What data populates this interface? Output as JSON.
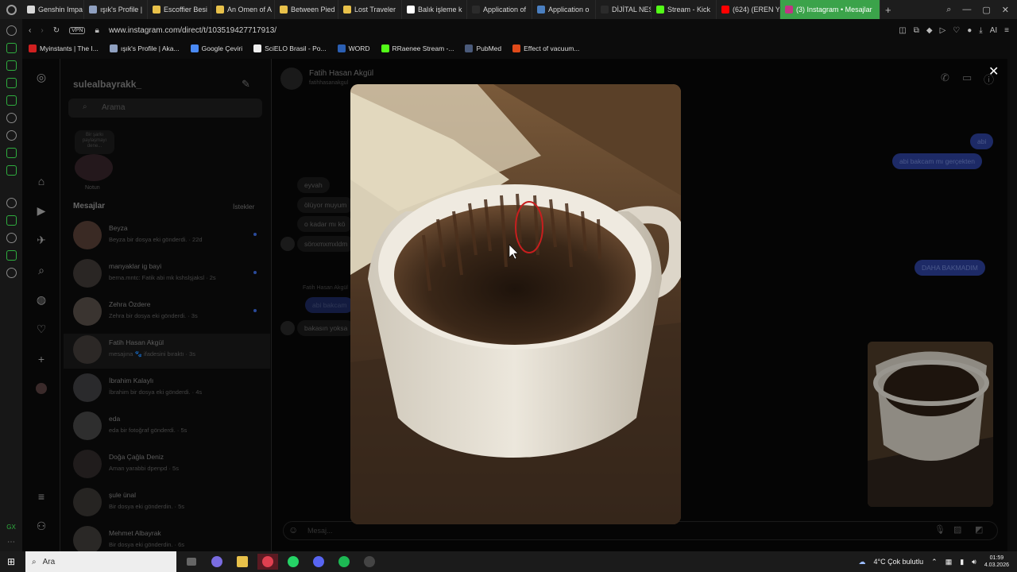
{
  "browser": {
    "tabs": [
      {
        "label": "Genshin Impa",
        "color": "#d9d9d9"
      },
      {
        "label": "ışık's Profile |",
        "color": "#8fa0c0"
      },
      {
        "label": "Escoffier Besi",
        "color": "#e8c14a"
      },
      {
        "label": "An Omen of A",
        "color": "#e8c14a"
      },
      {
        "label": "Between Pied",
        "color": "#e8c14a"
      },
      {
        "label": "Lost Traveler",
        "color": "#e8c14a"
      },
      {
        "label": "Balık işleme k",
        "color": "#ffffff"
      },
      {
        "label": "Application of",
        "color": "#2b2b2b"
      },
      {
        "label": "Application o",
        "color": "#4a7fc0"
      },
      {
        "label": "DİJİTAL NESN",
        "color": "#2b2b2b"
      },
      {
        "label": "Stream - Kick",
        "color": "#53fc18"
      },
      {
        "label": "(624) (EREN Y",
        "color": "#ff0000"
      },
      {
        "label": "(3) Instagram • Mesajlar",
        "color": "#c13584",
        "active": true
      }
    ],
    "new_tab": "+",
    "url": "www.instagram.com/direct/t/103519427717913/",
    "vpn": "VPN",
    "bookmarks": [
      {
        "label": "Myinstants | The I...",
        "color": "#d02020"
      },
      {
        "label": "ışık's Profile | Aka...",
        "color": "#8fa0c0"
      },
      {
        "label": "Google Çeviri",
        "color": "#4a8af4"
      },
      {
        "label": "SciELO Brasil - Po...",
        "color": "#eeeeee"
      },
      {
        "label": "WORD",
        "color": "#2b5fb3"
      },
      {
        "label": "RRaenee Stream -...",
        "color": "#53fc18"
      },
      {
        "label": "PubMed",
        "color": "#4a5a7a"
      },
      {
        "label": "Effect of vacuum...",
        "color": "#e04a1a"
      }
    ]
  },
  "instagram": {
    "username": "sulealbayrakk_",
    "search_placeholder": "Arama",
    "note_text": "Bir şarkı paylaşmayı dene...",
    "note_label": "Notun",
    "messages_heading": "Mesajlar",
    "requests_label": "İstekler",
    "conversations": [
      {
        "name": "Beyza",
        "preview": "Beyza bir dosya eki gönderdi. · 22d",
        "unread": true
      },
      {
        "name": "manyaklar ig bayi",
        "preview": "berna.mntc: Fatik abi mk kshslşjaksl · 2s",
        "unread": true
      },
      {
        "name": "Zehra Özdere",
        "preview": "Zehra bir dosya eki gönderdi. · 3s",
        "unread": true
      },
      {
        "name": "Fatih Hasan Akgül",
        "preview": "mesajına 🐾 ifadesini bıraktı · 3s",
        "unread": false
      },
      {
        "name": "İbrahim Kalaylı",
        "preview": "İbrahim bir dosya eki gönderdi. · 4s",
        "unread": false
      },
      {
        "name": "eda",
        "preview": "eda bir fotoğraf gönderdi. · 5s",
        "unread": false
      },
      {
        "name": "Doğa Çağla Deniz",
        "preview": "Aman yarabbi dpenpd · 5s",
        "unread": false
      },
      {
        "name": "şule ünal",
        "preview": "Bir dosya eki gönderdin. · 5s",
        "unread": false
      },
      {
        "name": "Mehmet Albayrak",
        "preview": "Bir dosya eki gönderdin. · 6s",
        "unread": false
      }
    ],
    "chat": {
      "contact_name": "Fatih Hasan Akgül",
      "contact_handle": "fatihhasanakgul",
      "sender_label": "Fatih Hasan Akgül",
      "messages_in": [
        "eyvah",
        "ölüyor muyum",
        "o kadar mı kö",
        "sönxmxmxldm",
        "bakasın yoksa"
      ],
      "messages_out": [
        "abi",
        "abi bakcam mı gerçekten",
        "DAHA BAKMADIM",
        "abi bakcam"
      ],
      "input_placeholder": "Mesaj..."
    }
  },
  "taskbar": {
    "search_placeholder": "Ara",
    "weather": "4°C  Çok bulutlu",
    "time": "01:59",
    "date": "4.03.2026"
  }
}
